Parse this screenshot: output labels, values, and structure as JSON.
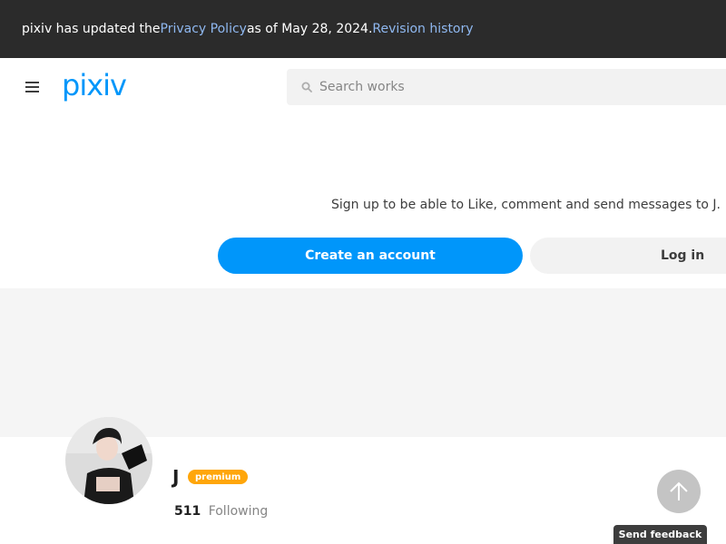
{
  "notice": {
    "prefix": "pixiv has updated the ",
    "policy_link": "Privacy Policy",
    "middle": " as of May 28, 2024. ",
    "history_link": "Revision history"
  },
  "header": {
    "logo_text": "pixiv",
    "search": {
      "placeholder": "Search works",
      "value": ""
    }
  },
  "signup": {
    "message": "Sign up to be able to Like, comment and send messages to J.",
    "create_label": "Create an account",
    "login_label": "Log in"
  },
  "profile": {
    "name": "J",
    "badge": "premium",
    "following_count": "511",
    "following_label": "Following"
  },
  "feedback": {
    "label": "Send feedback"
  },
  "colors": {
    "accent": "#0096fa",
    "premium": "#ffa60a",
    "notice_bg": "#2b2b2b"
  }
}
